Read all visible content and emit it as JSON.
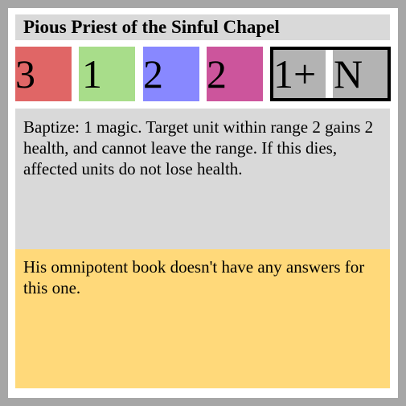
{
  "card": {
    "title": "Pious Priest of the Sinful Chapel",
    "stats": {
      "red": "3",
      "green": "1",
      "blue": "2",
      "pink": "2"
    },
    "cost": {
      "left": "1+",
      "right": "N"
    },
    "ability_text": "Baptize: 1 magic. Target unit within range 2 gains 2 health, and cannot leave the range. If this dies, affected units do not lose health.",
    "flavor_text": "His omnipotent book doesn't have any answers for this one."
  },
  "colors": {
    "border": "#a6a6a6",
    "panel_gray": "#d9d9d9",
    "red": "#e06666",
    "green": "#a8dd8a",
    "blue": "#8888ff",
    "pink": "#cc559c",
    "flavor_yellow": "#ffd97a",
    "cost_bg": "#b3b3b3"
  }
}
